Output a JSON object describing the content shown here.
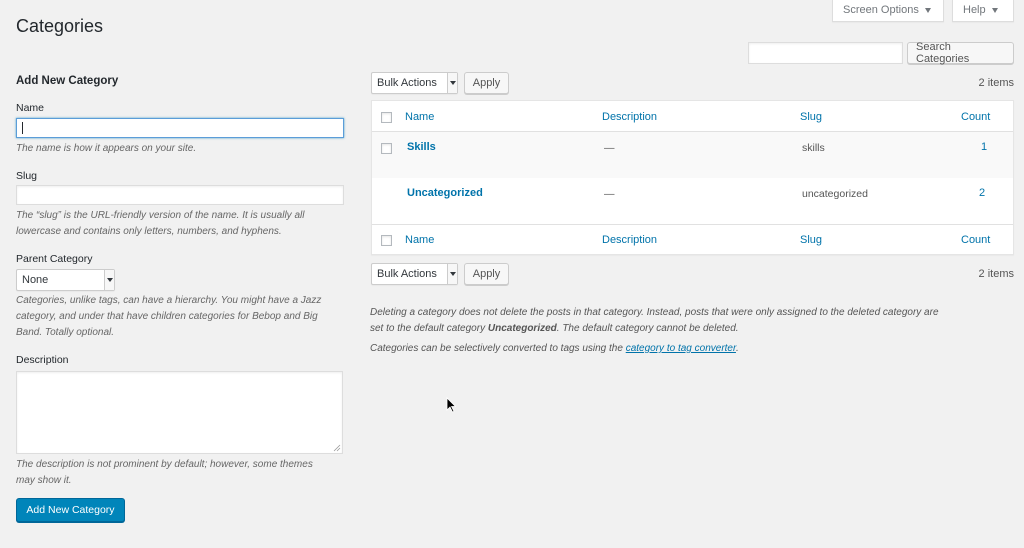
{
  "header": {
    "page_title": "Categories",
    "screen_options_label": "Screen Options",
    "help_label": "Help"
  },
  "search": {
    "placeholder": "",
    "value": "",
    "button_label": "Search Categories"
  },
  "form": {
    "heading": "Add New Category",
    "name_label": "Name",
    "name_value": "",
    "name_help": "The name is how it appears on your site.",
    "slug_label": "Slug",
    "slug_value": "",
    "slug_help_line1": "The “slug” is the URL-friendly version of the name. It is usually all",
    "slug_help_line2": "lowercase and contains only letters, numbers, and hyphens.",
    "parent_label": "Parent Category",
    "parent_selected": "None",
    "parent_help_line1": "Categories, unlike tags, can have a hierarchy. You might have a Jazz",
    "parent_help_line2": "category, and under that have children categories for Bebop and Big",
    "parent_help_line3": "Band. Totally optional.",
    "description_label": "Description",
    "description_value": "",
    "description_help_line1": "The description is not prominent by default; however, some themes",
    "description_help_line2": "may show it.",
    "submit_label": "Add New Category"
  },
  "bulk": {
    "top_select": "Bulk Actions",
    "bottom_select": "Bulk Actions",
    "apply_label": "Apply",
    "items_count": "2 items"
  },
  "table": {
    "columns": {
      "name": "Name",
      "description": "Description",
      "slug": "Slug",
      "count": "Count"
    },
    "rows": [
      {
        "name": "Skills",
        "description": "—",
        "slug": "skills",
        "count": "1"
      },
      {
        "name": "Uncategorized",
        "description": "—",
        "slug": "uncategorized",
        "count": "2"
      }
    ]
  },
  "notes": {
    "delete_line1": "Deleting a category does not delete the posts in that category. Instead, posts that were only assigned to the deleted category are",
    "delete_line2_prefix": "set to the default category ",
    "delete_line2_bold": "Uncategorized",
    "delete_line2_suffix": ". The default category cannot be deleted.",
    "convert_prefix": "Categories can be selectively converted to tags using the ",
    "convert_link": "category to tag converter",
    "convert_suffix": "."
  },
  "icons": {
    "caret": "caret-down-icon",
    "cursor": "mouse-pointer-icon"
  },
  "colors": {
    "accent": "#0073aa",
    "primary_button": "#0085ba",
    "background": "#f1f1f1"
  }
}
